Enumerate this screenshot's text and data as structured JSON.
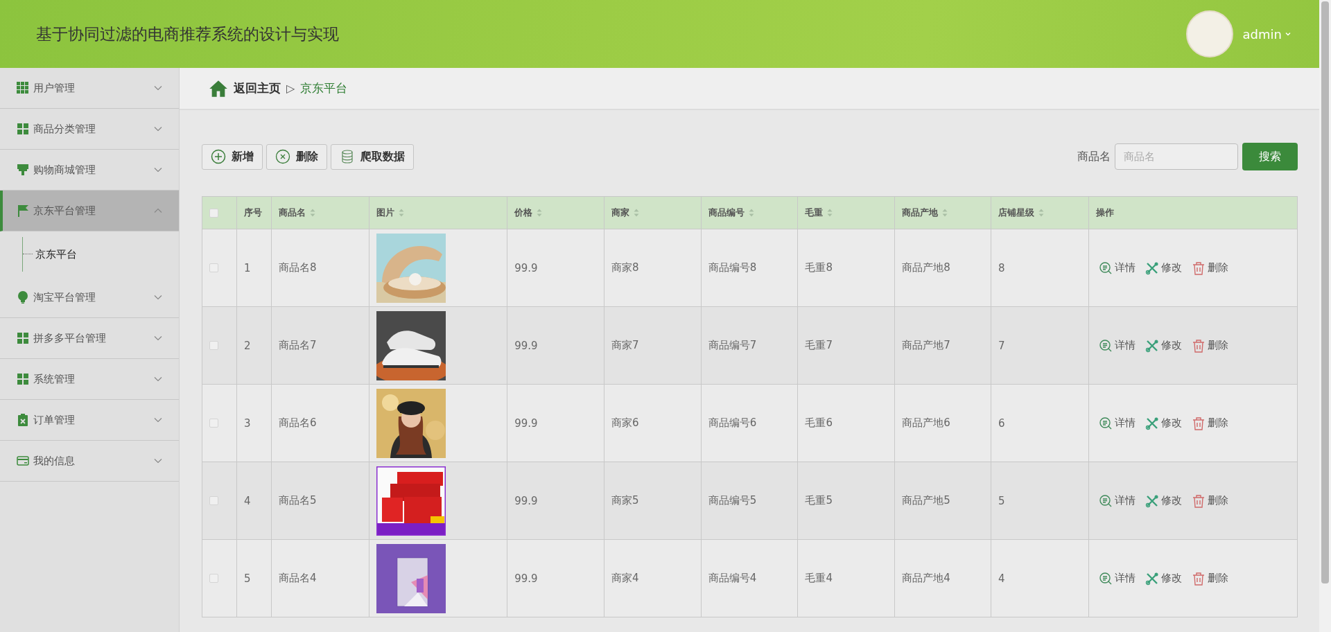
{
  "header": {
    "title": "基于协同过滤的电商推荐系统的设计与实现",
    "user": "admin"
  },
  "sidebar": {
    "items": [
      {
        "label": "用户管理",
        "expanded": false,
        "selected": false
      },
      {
        "label": "商品分类管理",
        "expanded": false,
        "selected": false
      },
      {
        "label": "购物商城管理",
        "expanded": false,
        "selected": false
      },
      {
        "label": "京东平台管理",
        "expanded": true,
        "selected": true,
        "children": [
          {
            "label": "京东平台"
          }
        ]
      },
      {
        "label": "淘宝平台管理",
        "expanded": false,
        "selected": false
      },
      {
        "label": "拼多多平台管理",
        "expanded": false,
        "selected": false
      },
      {
        "label": "系统管理",
        "expanded": false,
        "selected": false
      },
      {
        "label": "订单管理",
        "expanded": false,
        "selected": false
      },
      {
        "label": "我的信息",
        "expanded": false,
        "selected": false
      }
    ]
  },
  "breadcrumb": {
    "home": "返回主页",
    "separator": "▷",
    "current": "京东平台"
  },
  "toolbar": {
    "buttons": [
      {
        "label": "新增",
        "kind": "add"
      },
      {
        "label": "删除",
        "kind": "delete"
      },
      {
        "label": "爬取数据",
        "kind": "crawl"
      }
    ],
    "search": {
      "label": "商品名",
      "placeholder": "商品名",
      "button": "搜索"
    }
  },
  "table": {
    "header_checked": false,
    "columns": [
      {
        "label": "序号",
        "sortable": false
      },
      {
        "label": "商品名",
        "sortable": true
      },
      {
        "label": "图片",
        "sortable": true
      },
      {
        "label": "价格",
        "sortable": true
      },
      {
        "label": "商家",
        "sortable": true
      },
      {
        "label": "商品编号",
        "sortable": true
      },
      {
        "label": "毛重",
        "sortable": true
      },
      {
        "label": "商品产地",
        "sortable": true
      },
      {
        "label": "店铺星级",
        "sortable": true
      },
      {
        "label": "操作",
        "sortable": false
      }
    ],
    "rows": [
      {
        "checked": false,
        "cells": [
          "1",
          "商品名8",
          "",
          "99.9",
          "商家8",
          "商品编号8",
          "毛重8",
          "商品产地8",
          "8"
        ],
        "actions": [
          {
            "label": "详情",
            "kind": "detail"
          },
          {
            "label": "修改",
            "kind": "edit"
          },
          {
            "label": "删除",
            "kind": "delete"
          }
        ]
      },
      {
        "checked": false,
        "cells": [
          "2",
          "商品名7",
          "",
          "99.9",
          "商家7",
          "商品编号7",
          "毛重7",
          "商品产地7",
          "7"
        ],
        "actions": [
          {
            "label": "详情",
            "kind": "detail"
          },
          {
            "label": "修改",
            "kind": "edit"
          },
          {
            "label": "删除",
            "kind": "delete"
          }
        ]
      },
      {
        "checked": false,
        "cells": [
          "3",
          "商品名6",
          "",
          "99.9",
          "商家6",
          "商品编号6",
          "毛重6",
          "商品产地6",
          "6"
        ],
        "actions": [
          {
            "label": "详情",
            "kind": "detail"
          },
          {
            "label": "修改",
            "kind": "edit"
          },
          {
            "label": "删除",
            "kind": "delete"
          }
        ]
      },
      {
        "checked": false,
        "cells": [
          "4",
          "商品名5",
          "",
          "99.9",
          "商家5",
          "商品编号5",
          "毛重5",
          "商品产地5",
          "5"
        ],
        "actions": [
          {
            "label": "详情",
            "kind": "detail"
          },
          {
            "label": "修改",
            "kind": "edit"
          },
          {
            "label": "删除",
            "kind": "delete"
          }
        ]
      },
      {
        "checked": false,
        "cells": [
          "5",
          "商品名4",
          "",
          "99.9",
          "商家4",
          "商品编号4",
          "毛重4",
          "商品产地4",
          "4"
        ],
        "actions": [
          {
            "label": "详情",
            "kind": "detail"
          },
          {
            "label": "修改",
            "kind": "edit"
          },
          {
            "label": "删除",
            "kind": "delete"
          }
        ]
      }
    ]
  }
}
